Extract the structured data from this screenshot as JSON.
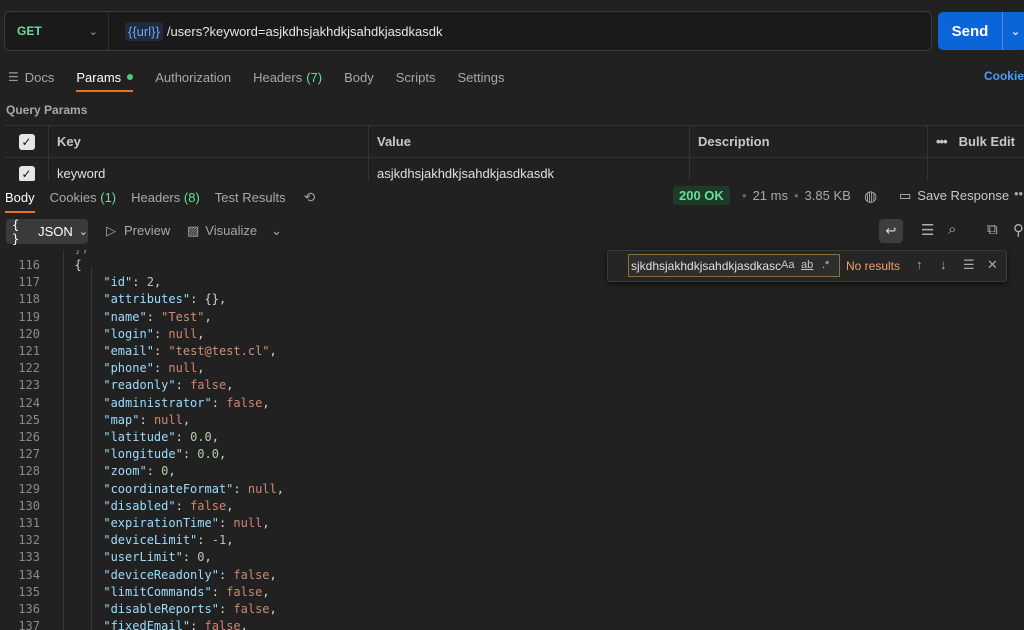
{
  "request": {
    "method": "GET",
    "url_var": "{{url}}",
    "url_rest": "/users?keyword=asjkdhsjakhdkjsahdkjasdkasdk",
    "send_label": "Send"
  },
  "tabs": {
    "docs": "Docs",
    "params": "Params",
    "authorization": "Authorization",
    "headers": "Headers",
    "headers_count": "(7)",
    "body": "Body",
    "scripts": "Scripts",
    "settings": "Settings",
    "cookies": "Cookie"
  },
  "query_params": {
    "title": "Query Params",
    "headers": {
      "key": "Key",
      "value": "Value",
      "description": "Description",
      "bulk_edit": "Bulk Edit"
    },
    "rows": [
      {
        "key": "keyword",
        "value": "asjkdhsjakhdkjsahdkjasdkasdk",
        "description": ""
      }
    ]
  },
  "response": {
    "tabs": {
      "body": "Body",
      "cookies": "Cookies",
      "cookies_count": "(1)",
      "headers": "Headers",
      "headers_count": "(8)",
      "test_results": "Test Results"
    },
    "status": "200 OK",
    "time": "21 ms",
    "size": "3.85 KB",
    "save_label": "Save Response",
    "format": "JSON",
    "preview": "Preview",
    "visualize": "Visualize"
  },
  "find": {
    "query": "sjkdhsjakhdkjsahdkjasdkasc",
    "match_case": "Aa",
    "whole_word": "ab",
    "regex": ".*",
    "result": "No results"
  },
  "code_lines": [
    {
      "n": "116",
      "indent": 1,
      "key": null,
      "val": "{",
      "vt": "p",
      "comma": false
    },
    {
      "n": "117",
      "indent": 2,
      "key": "id",
      "val": "2",
      "vt": "n",
      "comma": true
    },
    {
      "n": "118",
      "indent": 2,
      "key": "attributes",
      "val": "{}",
      "vt": "p",
      "comma": true
    },
    {
      "n": "119",
      "indent": 2,
      "key": "name",
      "val": "\"Test\"",
      "vt": "s",
      "comma": true
    },
    {
      "n": "120",
      "indent": 2,
      "key": "login",
      "val": "null",
      "vt": "kw",
      "comma": true
    },
    {
      "n": "121",
      "indent": 2,
      "key": "email",
      "val": "\"test@test.cl\"",
      "vt": "s",
      "comma": true
    },
    {
      "n": "122",
      "indent": 2,
      "key": "phone",
      "val": "null",
      "vt": "kw",
      "comma": true
    },
    {
      "n": "123",
      "indent": 2,
      "key": "readonly",
      "val": "false",
      "vt": "kw",
      "comma": true
    },
    {
      "n": "124",
      "indent": 2,
      "key": "administrator",
      "val": "false",
      "vt": "kw",
      "comma": true
    },
    {
      "n": "125",
      "indent": 2,
      "key": "map",
      "val": "null",
      "vt": "kw",
      "comma": true
    },
    {
      "n": "126",
      "indent": 2,
      "key": "latitude",
      "val": "0.0",
      "vt": "n",
      "comma": true
    },
    {
      "n": "127",
      "indent": 2,
      "key": "longitude",
      "val": "0.0",
      "vt": "n",
      "comma": true
    },
    {
      "n": "128",
      "indent": 2,
      "key": "zoom",
      "val": "0",
      "vt": "n",
      "comma": true
    },
    {
      "n": "129",
      "indent": 2,
      "key": "coordinateFormat",
      "val": "null",
      "vt": "kw",
      "comma": true
    },
    {
      "n": "130",
      "indent": 2,
      "key": "disabled",
      "val": "false",
      "vt": "kw",
      "comma": true
    },
    {
      "n": "131",
      "indent": 2,
      "key": "expirationTime",
      "val": "null",
      "vt": "kw",
      "comma": true
    },
    {
      "n": "132",
      "indent": 2,
      "key": "deviceLimit",
      "val": "-1",
      "vt": "n",
      "comma": true
    },
    {
      "n": "133",
      "indent": 2,
      "key": "userLimit",
      "val": "0",
      "vt": "n",
      "comma": true
    },
    {
      "n": "134",
      "indent": 2,
      "key": "deviceReadonly",
      "val": "false",
      "vt": "kw",
      "comma": true
    },
    {
      "n": "135",
      "indent": 2,
      "key": "limitCommands",
      "val": "false",
      "vt": "kw",
      "comma": true
    },
    {
      "n": "136",
      "indent": 2,
      "key": "disableReports",
      "val": "false",
      "vt": "kw",
      "comma": true
    },
    {
      "n": "137",
      "indent": 2,
      "key": "fixedEmail",
      "val": "false",
      "vt": "kw",
      "comma": true
    }
  ]
}
